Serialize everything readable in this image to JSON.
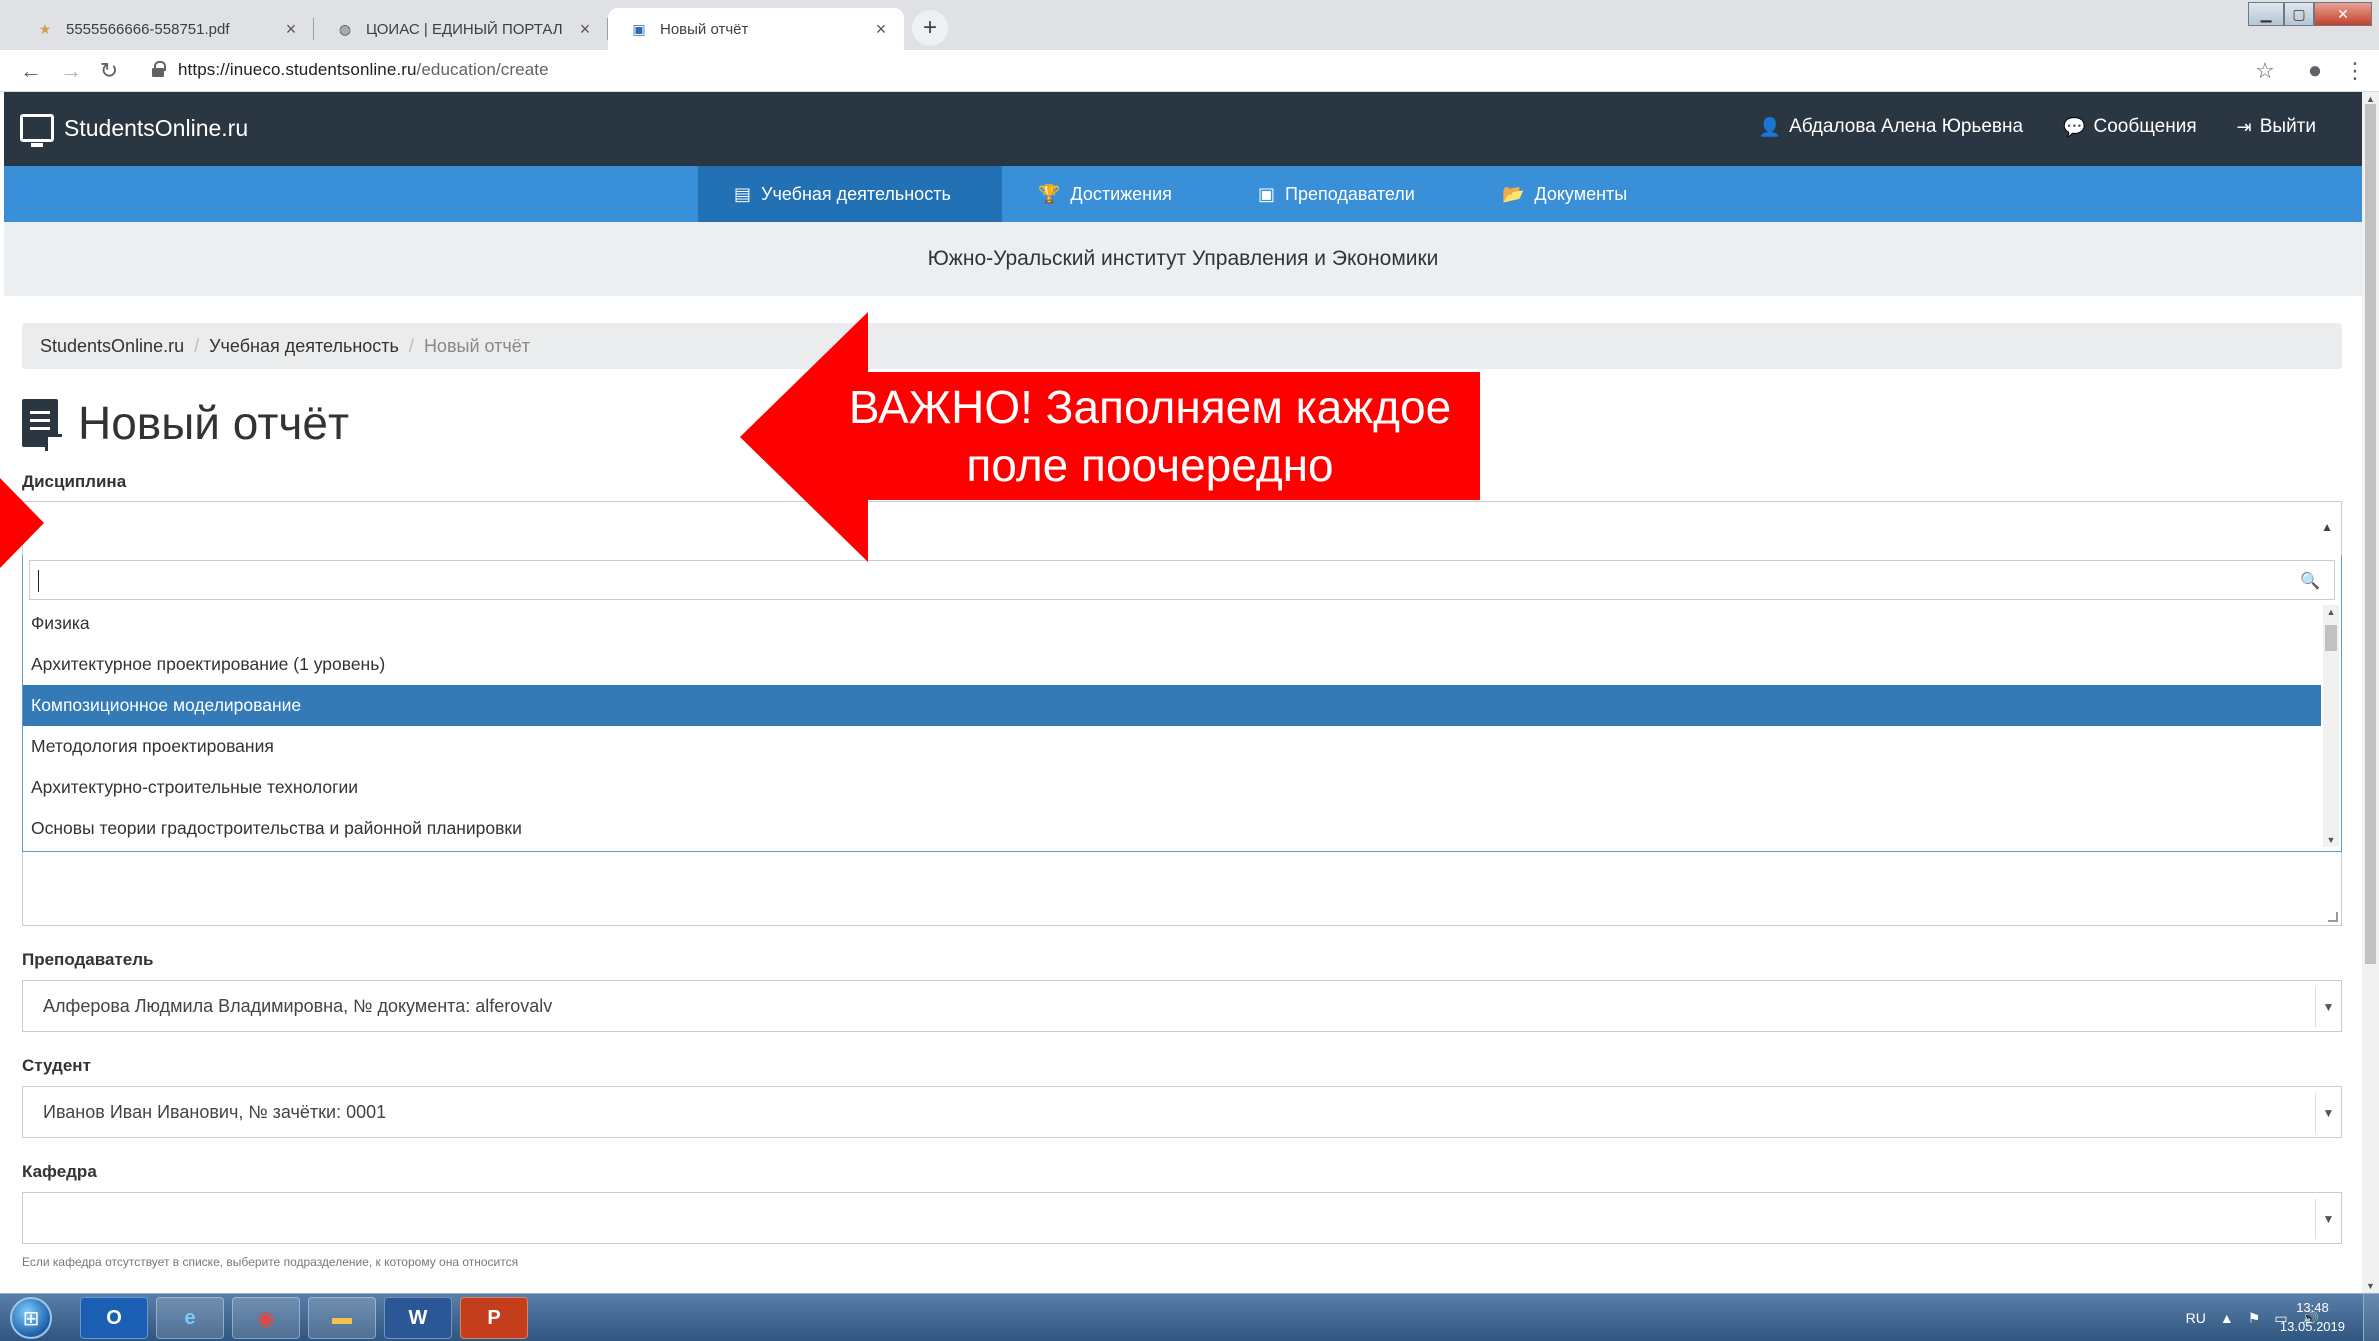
{
  "browser": {
    "tabs": [
      {
        "title": "5555566666-558751.pdf",
        "icon": "pdf-icon"
      },
      {
        "title": "ЦОИАС | ЕДИНЫЙ ПОРТАЛ инс",
        "icon": "globe-icon"
      },
      {
        "title": "Новый отчёт",
        "icon": "site-icon",
        "active": true
      }
    ],
    "url_host": "https://inueco.studentsonline.ru",
    "url_path": "/education/create"
  },
  "header": {
    "brand": "StudentsOnline.ru",
    "user": "Абдалова Алена Юрьевна",
    "messages": "Сообщения",
    "logout": "Выйти"
  },
  "nav": {
    "items": [
      {
        "label": "Учебная деятельность",
        "icon": "document-icon",
        "active": true
      },
      {
        "label": "Достижения",
        "icon": "trophy-icon"
      },
      {
        "label": "Преподаватели",
        "icon": "teacher-icon"
      },
      {
        "label": "Документы",
        "icon": "folder-icon"
      }
    ]
  },
  "institution": "Южно-Уральский институт Управления и Экономики",
  "breadcrumb": {
    "items": [
      "StudentsOnline.ru",
      "Учебная деятельность",
      "Новый отчёт"
    ]
  },
  "page": {
    "title": "Новый отчёт"
  },
  "form": {
    "discipline_label": "Дисциплина",
    "discipline_search_value": "",
    "discipline_options": [
      "Физика",
      "Архитектурное проектирование (1 уровень)",
      "Композиционное моделирование",
      "Методология проектирования",
      "Архитектурно-строительные технологии",
      "Основы теории градостроительства и районной планировки"
    ],
    "discipline_highlighted": "Композиционное моделирование",
    "teacher_label": "Преподаватель",
    "teacher_value": "Алферова Людмила Владимировна, № документа: alferovalv",
    "student_label": "Студент",
    "student_value": "Иванов Иван Иванович, № зачётки: 0001",
    "department_label": "Кафедра",
    "department_value": "",
    "department_help": "Если кафедра отсутствует в списке, выберите подразделение, к которому она относится"
  },
  "annotation": {
    "text_line1": "ВАЖНО! Заполняем каждое",
    "text_line2": "поле поочередно",
    "color": "#ff0000"
  },
  "taskbar": {
    "apps": [
      "outlook-icon",
      "ie-icon",
      "chrome-icon",
      "explorer-icon",
      "word-icon",
      "powerpoint-icon"
    ],
    "lang": "RU",
    "time": "13:48",
    "date": "13.05.2019"
  }
}
